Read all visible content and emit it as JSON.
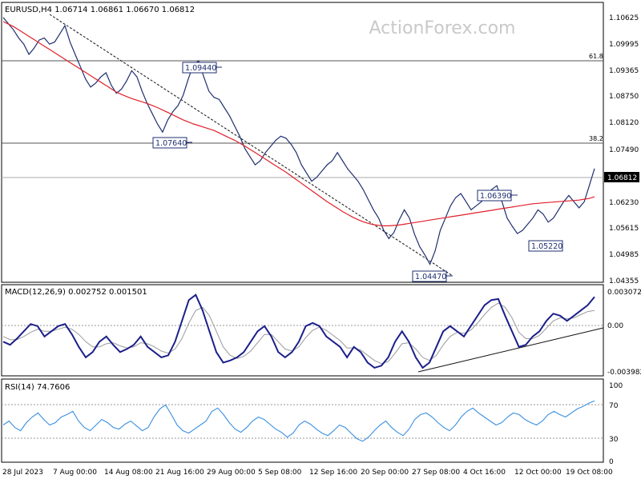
{
  "watermark": "ActionForex.com",
  "colors": {
    "price": "#1f2f6f",
    "ema": "#e0202a",
    "macd": "#1b1f8a",
    "signal": "#9a9a9a",
    "rsi": "#3a8fe0",
    "level": "#666666",
    "trend": "#111111",
    "grid_dotted": "#9a9a9a"
  },
  "chart_data": [
    {
      "type": "line",
      "panel": "price",
      "title": "EURUSD,H4 1.06714 1.06861 1.06670 1.06812",
      "y_ticks": [
        "1.10625",
        "1.09995",
        "1.09365",
        "1.08750",
        "1.08120",
        "1.07490",
        "1.06812",
        "1.06230",
        "1.05615",
        "1.04985",
        "1.04355"
      ],
      "ylim": [
        1.0405,
        1.1085
      ],
      "last_price_label": "1.06812",
      "fib_levels": [
        {
          "label": "61.8",
          "value": 1.0961
        },
        {
          "label": "38.2",
          "value": 1.0763
        }
      ],
      "callouts": [
        {
          "text": "1.09440"
        },
        {
          "text": "1.07640"
        },
        {
          "text": "1.06390"
        },
        {
          "text": "1.05220"
        },
        {
          "text": "1.04470"
        }
      ],
      "series": [
        {
          "values": [
            1.105,
            1.1035,
            1.102,
            1.1,
            1.0985,
            1.096,
            1.0975,
            1.0995,
            1.1,
            1.0985,
            1.099,
            1.101,
            1.103,
            1.099,
            1.096,
            1.093,
            1.09,
            1.088,
            1.089,
            1.0905,
            1.0915,
            1.0885,
            1.0865,
            1.0875,
            1.0895,
            1.092,
            1.0905,
            1.087,
            1.084,
            1.0815,
            1.079,
            1.077,
            1.08,
            1.082,
            1.0835,
            1.086,
            1.09,
            1.0935,
            1.0944,
            1.0905,
            1.087,
            1.0855,
            1.085,
            1.083,
            1.081,
            1.0785,
            1.076,
            1.073,
            1.071,
            1.069,
            1.07,
            1.072,
            1.0735,
            1.075,
            1.076,
            1.0755,
            1.074,
            1.072,
            1.069,
            1.067,
            1.065,
            1.066,
            1.0675,
            1.069,
            1.07,
            1.072,
            1.07,
            1.068,
            1.0665,
            1.065,
            1.063,
            1.0605,
            1.058,
            1.056,
            1.053,
            1.051,
            1.0525,
            1.0555,
            1.058,
            1.056,
            1.052,
            1.049,
            1.047,
            1.0447,
            1.048,
            1.053,
            1.056,
            1.059,
            1.061,
            1.062,
            1.06,
            1.058,
            1.059,
            1.06,
            1.0615,
            1.063,
            1.0639,
            1.06,
            1.056,
            1.054,
            1.0522,
            1.053,
            1.0545,
            1.056,
            1.058,
            1.057,
            1.055,
            1.056,
            1.058,
            1.06,
            1.0615,
            1.06,
            1.0585,
            1.06,
            1.064,
            1.0681
          ]
        },
        {
          "values": [
            1.104,
            1.1034,
            1.1028,
            1.102,
            1.1012,
            1.1004,
            1.0996,
            1.0988,
            1.098,
            1.0972,
            1.0964,
            1.0956,
            1.0948,
            1.094,
            1.0932,
            1.0924,
            1.0916,
            1.0908,
            1.09,
            1.0892,
            1.0884,
            1.0876,
            1.0868,
            1.0862,
            1.0857,
            1.0852,
            1.0848,
            1.0844,
            1.084,
            1.0835,
            1.083,
            1.0824,
            1.0818,
            1.0812,
            1.0806,
            1.08,
            1.0795,
            1.079,
            1.0786,
            1.0782,
            1.0778,
            1.0774,
            1.0768,
            1.0762,
            1.0756,
            1.075,
            1.0743,
            1.0736,
            1.0728,
            1.072,
            1.0712,
            1.0704,
            1.0696,
            1.0688,
            1.068,
            1.0672,
            1.0663,
            1.0654,
            1.0645,
            1.0636,
            1.0627,
            1.0618,
            1.0609,
            1.06,
            1.0592,
            1.0584,
            1.0576,
            1.0569,
            1.0562,
            1.0556,
            1.0551,
            1.0547,
            1.0544,
            1.0542,
            1.0541,
            1.0541,
            1.0542,
            1.0543,
            1.0545,
            1.0547,
            1.0549,
            1.0551,
            1.0553,
            1.0555,
            1.0557,
            1.0559,
            1.0561,
            1.0563,
            1.0565,
            1.0567,
            1.0569,
            1.0571,
            1.0573,
            1.0575,
            1.0577,
            1.0579,
            1.0581,
            1.0583,
            1.0585,
            1.0587,
            1.0589,
            1.0591,
            1.0593,
            1.0595,
            1.0596,
            1.0597,
            1.0598,
            1.0599,
            1.06,
            1.0601,
            1.0602,
            1.0603,
            1.0604,
            1.0606,
            1.0608,
            1.0612
          ]
        }
      ]
    },
    {
      "type": "line",
      "panel": "macd",
      "title": "MACD(12,26,9) 0.002752 0.001501",
      "y_ticks": [
        "0.003072",
        "0.00",
        "-0.003982"
      ],
      "ylim": [
        -0.0047,
        0.0039
      ],
      "series": [
        {
          "values": [
            -0.0015,
            -0.0018,
            -0.0012,
            -0.0005,
            0.0002,
            0.0,
            -0.001,
            -0.0005,
            0.0,
            0.0002,
            -0.0008,
            -0.002,
            -0.003,
            -0.0025,
            -0.0015,
            -0.001,
            -0.0018,
            -0.0025,
            -0.0022,
            -0.0018,
            -0.001,
            -0.002,
            -0.0025,
            -0.003,
            -0.0028,
            -0.0015,
            0.0005,
            0.0025,
            0.003,
            0.0015,
            -0.0005,
            -0.0025,
            -0.0035,
            -0.0033,
            -0.003,
            -0.0025,
            -0.0015,
            -0.0005,
            0.0,
            -0.001,
            -0.0025,
            -0.003,
            -0.0025,
            -0.0015,
            0.0,
            0.0003,
            0.0,
            -0.001,
            -0.0015,
            -0.002,
            -0.003,
            -0.002,
            -0.0025,
            -0.0035,
            -0.004,
            -0.0038,
            -0.003,
            -0.0015,
            -0.0005,
            -0.0015,
            -0.003,
            -0.004,
            -0.0035,
            -0.002,
            -0.0005,
            0.0,
            -0.0005,
            -0.001,
            0.0,
            0.001,
            0.002,
            0.0025,
            0.0026,
            0.001,
            -0.0005,
            -0.002,
            -0.0018,
            -0.001,
            -0.0005,
            0.0005,
            0.0012,
            0.001,
            0.0005,
            0.001,
            0.0015,
            0.002,
            0.0028
          ]
        },
        {
          "values": [
            -0.001,
            -0.0013,
            -0.0013,
            -0.001,
            -0.0006,
            -0.0003,
            -0.0005,
            -0.0005,
            -0.0003,
            -0.0001,
            -0.0003,
            -0.0008,
            -0.0015,
            -0.002,
            -0.002,
            -0.0017,
            -0.0016,
            -0.0019,
            -0.0021,
            -0.002,
            -0.0016,
            -0.0017,
            -0.002,
            -0.0024,
            -0.0026,
            -0.0022,
            -0.0012,
            0.0003,
            0.0015,
            0.0018,
            0.001,
            -0.0005,
            -0.002,
            -0.0028,
            -0.0031,
            -0.0029,
            -0.0024,
            -0.0016,
            -0.0008,
            -0.0008,
            -0.0015,
            -0.0022,
            -0.0024,
            -0.002,
            -0.0011,
            -0.0004,
            -0.0001,
            -0.0004,
            -0.0009,
            -0.0014,
            -0.0021,
            -0.0021,
            -0.0023,
            -0.0028,
            -0.0033,
            -0.0036,
            -0.0034,
            -0.0026,
            -0.0017,
            -0.0016,
            -0.0022,
            -0.003,
            -0.0033,
            -0.0028,
            -0.0018,
            -0.001,
            -0.0006,
            -0.0007,
            -0.0004,
            0.0003,
            0.0011,
            0.0018,
            0.0022,
            0.0018,
            0.0008,
            -0.0006,
            -0.0012,
            -0.0012,
            -0.0009,
            -0.0002,
            0.0005,
            0.0008,
            0.0007,
            0.0008,
            0.0011,
            0.0014,
            0.0015
          ]
        }
      ]
    },
    {
      "type": "line",
      "panel": "rsi",
      "title": "RSI(14) 74.7606",
      "y_ticks": [
        "100",
        "70",
        "30",
        "0"
      ],
      "ylim": [
        0,
        100
      ],
      "levels": [
        70,
        30
      ],
      "series": [
        {
          "values": [
            45,
            50,
            42,
            38,
            48,
            55,
            60,
            52,
            45,
            48,
            55,
            58,
            62,
            50,
            42,
            38,
            45,
            52,
            48,
            42,
            40,
            46,
            50,
            44,
            38,
            42,
            55,
            65,
            70,
            58,
            45,
            38,
            35,
            40,
            45,
            50,
            62,
            66,
            58,
            48,
            40,
            36,
            42,
            50,
            55,
            52,
            46,
            40,
            36,
            30,
            35,
            45,
            50,
            46,
            40,
            35,
            32,
            38,
            45,
            42,
            35,
            28,
            25,
            30,
            38,
            45,
            50,
            42,
            36,
            32,
            40,
            52,
            58,
            60,
            55,
            48,
            42,
            38,
            45,
            55,
            62,
            66,
            60,
            55,
            50,
            45,
            48,
            55,
            60,
            58,
            52,
            48,
            45,
            50,
            58,
            62,
            58,
            55,
            60,
            65,
            68,
            72,
            75
          ]
        }
      ]
    }
  ],
  "x_axis": {
    "labels": [
      "28 Jul 2023",
      "7 Aug 00:00",
      "14 Aug 08:00",
      "21 Aug 16:00",
      "29 Aug 00:00",
      "5 Sep 08:00",
      "12 Sep 16:00",
      "20 Sep 00:00",
      "27 Sep 08:00",
      "4 Oct 16:00",
      "12 Oct 00:00",
      "19 Oct 08:00"
    ]
  }
}
